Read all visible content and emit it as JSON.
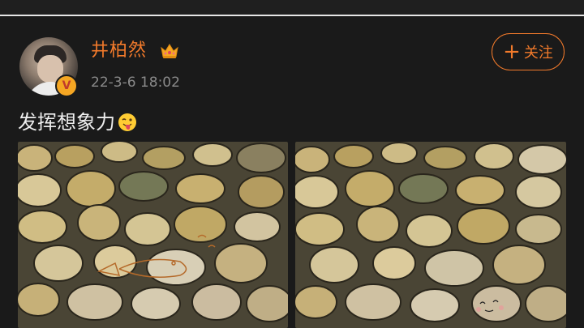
{
  "post": {
    "username": "井柏然",
    "timestamp": "22-3-6 18:02",
    "follow_label": "关注",
    "text": "发挥想象力",
    "badge": "V"
  },
  "colors": {
    "accent": "#f27a2b",
    "background": "#1a1a1a",
    "verified": "#f5a623"
  },
  "icons": {
    "crown": "crown-icon",
    "emoji": "tongue-out-emoji",
    "plus": "plus-icon"
  }
}
